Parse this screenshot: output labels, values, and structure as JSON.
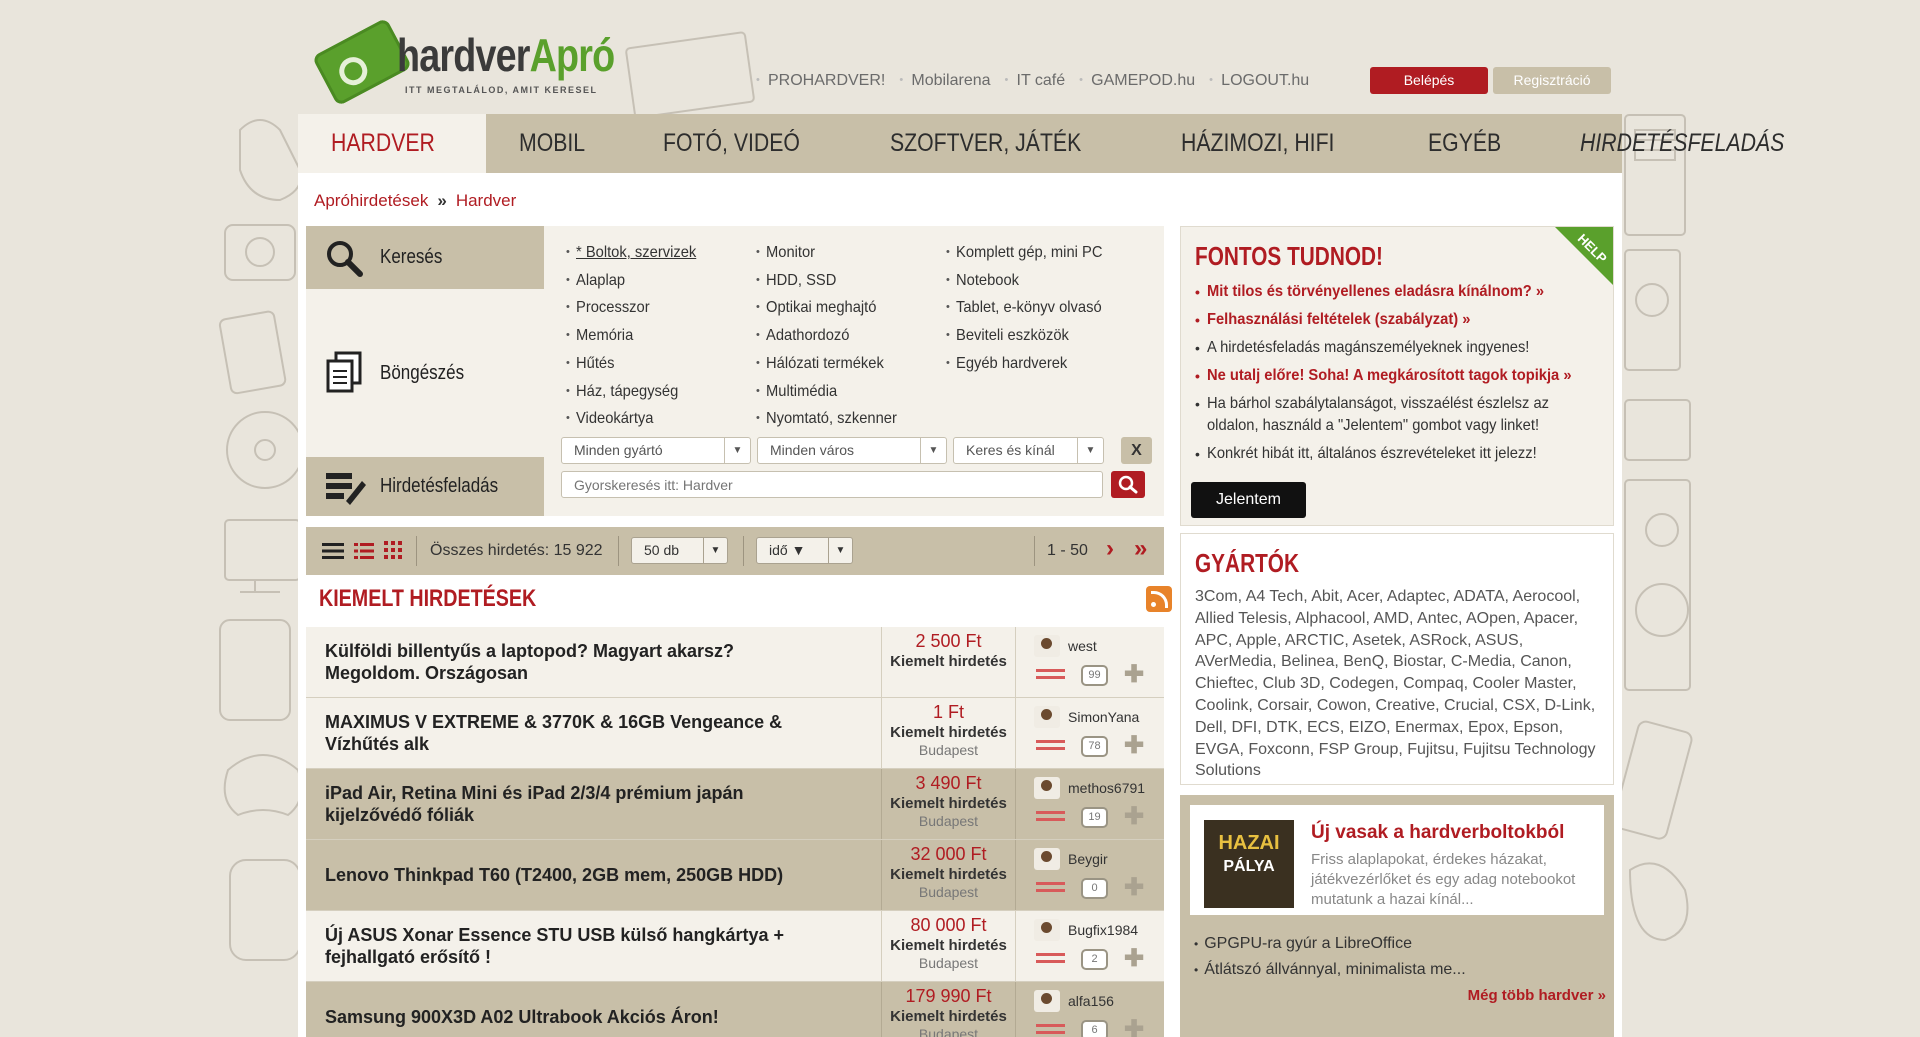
{
  "logo": {
    "name_a": "hardver",
    "name_b": "Apró",
    "slogan": "ITT MEGTALÁLOD, AMIT KERESEL"
  },
  "top_links": [
    "PROHARDVER!",
    "Mobilarena",
    "IT café",
    "GAMEPOD.hu",
    "LOGOUT.hu"
  ],
  "auth": {
    "login": "Belépés",
    "register": "Regisztráció"
  },
  "nav": [
    "HARDVER",
    "MOBIL",
    "FOTÓ, VIDEÓ",
    "SZOFTVER, JÁTÉK",
    "HÁZIMOZI, HIFI",
    "EGYÉB",
    "HIRDETÉSFELADÁS"
  ],
  "breadcrumb": [
    "Apróhirdetések",
    "Hardver"
  ],
  "side_tabs": {
    "search": "Keresés",
    "browse": "Böngészés",
    "post": "Hirdetésfeladás"
  },
  "categories": {
    "col1": [
      "* Boltok, szervizek",
      "Alaplap",
      "Processzor",
      "Memória",
      "Hűtés",
      "Ház, tápegység",
      "Videokártya"
    ],
    "col2": [
      "Monitor",
      "HDD, SSD",
      "Optikai meghajtó",
      "Adathordozó",
      "Hálózati termékek",
      "Multimédia",
      "Nyomtató, szkenner"
    ],
    "col3": [
      "Komplett gép, mini PC",
      "Notebook",
      "Tablet, e-könyv olvasó",
      "Beviteli eszközök",
      "Egyéb hardverek"
    ]
  },
  "filters": {
    "maker": "Minden gyártó",
    "city": "Minden város",
    "type": "Keres és kínál",
    "clear": "X",
    "quicksearch_placeholder": "Gyorskeresés itt: Hardver"
  },
  "toolbar": {
    "total": "Összes hirdetés: 15 922",
    "per_page": "50 db",
    "sort": "idő ▼",
    "pages": "1 - 50",
    "next": "›",
    "last": "»"
  },
  "featured_title": "KIEMELT HIRDETÉSEK",
  "listings": [
    {
      "title": "Külföldi billentyűs a laptopod? Magyart akarsz? Megoldom. Országosan",
      "price": "2 500 Ft",
      "label": "Kiemelt hirdetés",
      "city": "",
      "user": "west",
      "comments": "99"
    },
    {
      "title": "MAXIMUS V EXTREME & 3770K & 16GB Vengeance & Vízhűtés alk",
      "price": "1 Ft",
      "label": "Kiemelt hirdetés",
      "city": "Budapest",
      "user": "SimonYana",
      "comments": "78"
    },
    {
      "title": "iPad Air, Retina Mini és iPad 2/3/4 prémium japán kijelzővédő fóliák",
      "price": "3 490 Ft",
      "label": "Kiemelt hirdetés",
      "city": "Budapest",
      "user": "methos6791",
      "comments": "19"
    },
    {
      "title": "Lenovo Thinkpad T60 (T2400, 2GB mem, 250GB HDD)",
      "price": "32 000 Ft",
      "label": "Kiemelt hirdetés",
      "city": "Budapest",
      "user": "Beygir",
      "comments": "0"
    },
    {
      "title": "Új ASUS Xonar Essence STU USB külső hangkártya + fejhallgató erősítő !",
      "price": "80 000 Ft",
      "label": "Kiemelt hirdetés",
      "city": "Budapest",
      "user": "Bugfix1984",
      "comments": "2"
    },
    {
      "title": "Samsung 900X3D A02 Ultrabook Akciós Áron!",
      "price": "179 990 Ft",
      "label": "Kiemelt hirdetés",
      "city": "Budapest",
      "user": "alfa156",
      "comments": "6"
    }
  ],
  "fontos": {
    "title": "FONTOS TUDNOD!",
    "help": "HELP",
    "items": [
      {
        "text": "Mit tilos és törvényellenes eladásra kínálnom? »",
        "red": true
      },
      {
        "text": "Felhasználási feltételek (szabályzat) »",
        "red": true
      },
      {
        "text": "A hirdetésfeladás magánszemélyeknek ingyenes!",
        "red": false
      },
      {
        "text": "Ne utalj előre! Soha! A megkárosított tagok topikja »",
        "red": true
      },
      {
        "text": "Ha bárhol szabálytalanságot, visszaélést észlelsz az oldalon, használd a \"Jelentem\" gombot vagy linket!",
        "red": false
      },
      {
        "text": "Konkrét hibát itt, általános észrevételeket itt jelezz!",
        "red": false
      }
    ],
    "report": "Jelentem"
  },
  "gyartok": {
    "title": "GYÁRTÓK",
    "list": "3Com, A4 Tech, Abit, Acer, Adaptec, ADATA, Aerocool, Allied Telesis, Alphacool, AMD, Antec, AOpen, Apacer, APC, Apple, ARCTIC, Asetek, ASRock, ASUS, AVerMedia, Belinea, BenQ, Biostar, C-Media, Canon, Chieftec, Club 3D, Codegen, Compaq, Cooler Master, Coolink, Corsair, Cowon, Creative, Crucial, CSX, D-Link, Dell, DFI, DTK, ECS, EIZO, Enermax, Epox, Epson, EVGA, Foxconn, FSP Group, Fujitsu, Fujitsu Technology Solutions"
  },
  "news": {
    "thumb_a": "HAZAI",
    "thumb_b": "PÁLYA",
    "title": "Új vasak a hardverboltokból",
    "desc": "Friss alaplapokat, érdekes házakat, játékvezérlőket és egy adag notebookot mutatunk a hazai kínál...",
    "links": [
      "GPGPU-ra gyúr a LibreOffice",
      "Átlátszó állvánnyal, minimalista me..."
    ],
    "more": "Még több hardver »"
  }
}
